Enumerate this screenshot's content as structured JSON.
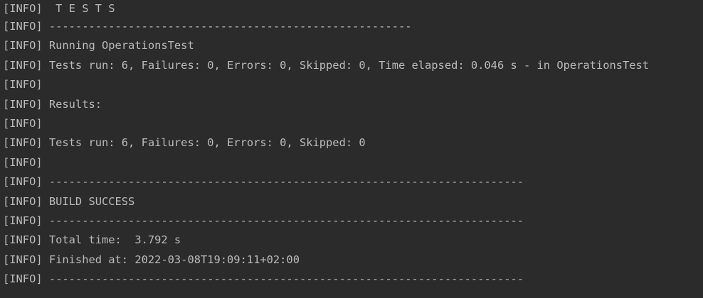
{
  "console": {
    "lines": [
      "[INFO]  T E S T S",
      "[INFO] -------------------------------------------------------",
      "[INFO] Running OperationsTest",
      "[INFO] Tests run: 6, Failures: 0, Errors: 0, Skipped: 0, Time elapsed: 0.046 s - in OperationsTest",
      "[INFO]",
      "[INFO] Results:",
      "[INFO]",
      "[INFO] Tests run: 6, Failures: 0, Errors: 0, Skipped: 0",
      "[INFO]",
      "[INFO] ------------------------------------------------------------------------",
      "[INFO] BUILD SUCCESS",
      "[INFO] ------------------------------------------------------------------------",
      "[INFO] Total time:  3.792 s",
      "[INFO] Finished at: 2022-03-08T19:09:11+02:00",
      "[INFO] ------------------------------------------------------------------------"
    ]
  },
  "colors": {
    "background": "#2b2b2b",
    "text": "#bbbbbb"
  }
}
